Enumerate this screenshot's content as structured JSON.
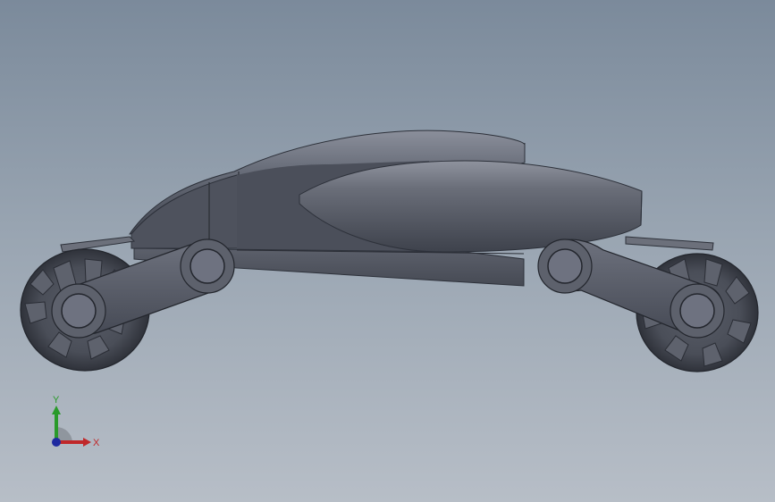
{
  "viewport": {
    "background_top": "#7b8a9b",
    "background_bottom": "#b7bec7"
  },
  "model": {
    "body_color": "#4d525f",
    "highlight_color": "#8a8e9a",
    "shadow_color": "#2d313a"
  },
  "triad": {
    "x_label": "X",
    "y_label": "Y",
    "x_color": "#c0282a",
    "y_color": "#2a9a2a",
    "z_color": "#1f2aa0"
  }
}
